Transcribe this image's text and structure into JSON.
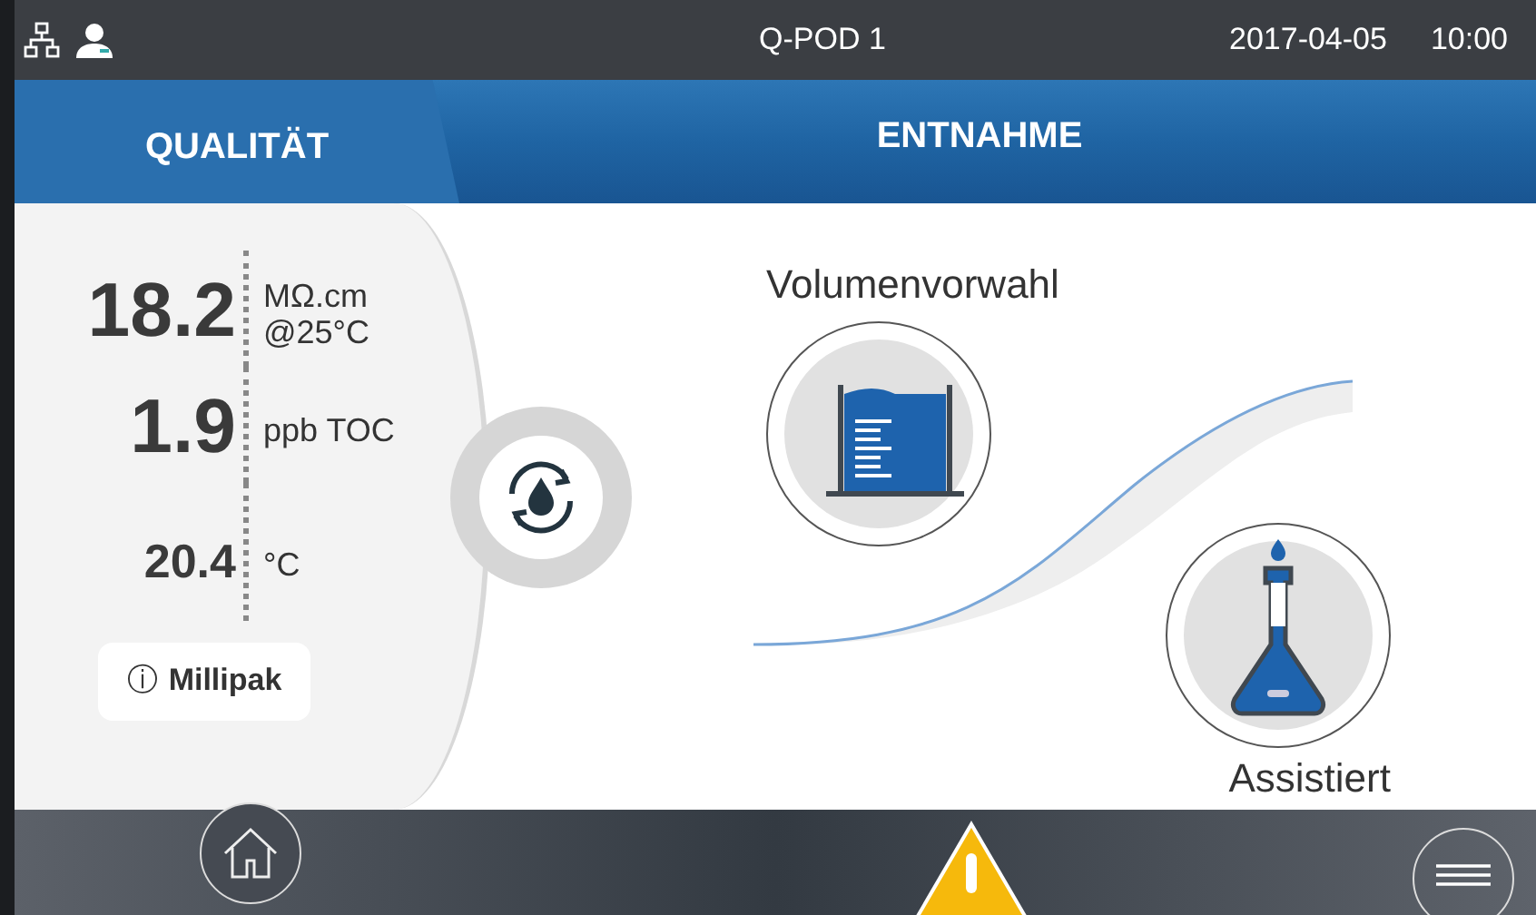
{
  "status_bar": {
    "title": "Q-POD 1",
    "date": "2017-04-05",
    "time": "10:00"
  },
  "header": {
    "left_title": "QUALITÄT",
    "right_title": "ENTNAHME"
  },
  "readings": [
    {
      "value": "18.2",
      "unit": "MΩ.cm\n@25°C",
      "kind": "large"
    },
    {
      "value": "1.9",
      "unit": "ppb TOC",
      "kind": "large"
    },
    {
      "value": "20.4",
      "unit": "°C",
      "kind": "small"
    }
  ],
  "info_button": {
    "icon": "ⓘ",
    "label": "Millipak"
  },
  "modes": [
    {
      "label": "Volumenvorwahl",
      "kind": "cylinder"
    },
    {
      "label": "Assistiert",
      "kind": "flask"
    }
  ]
}
